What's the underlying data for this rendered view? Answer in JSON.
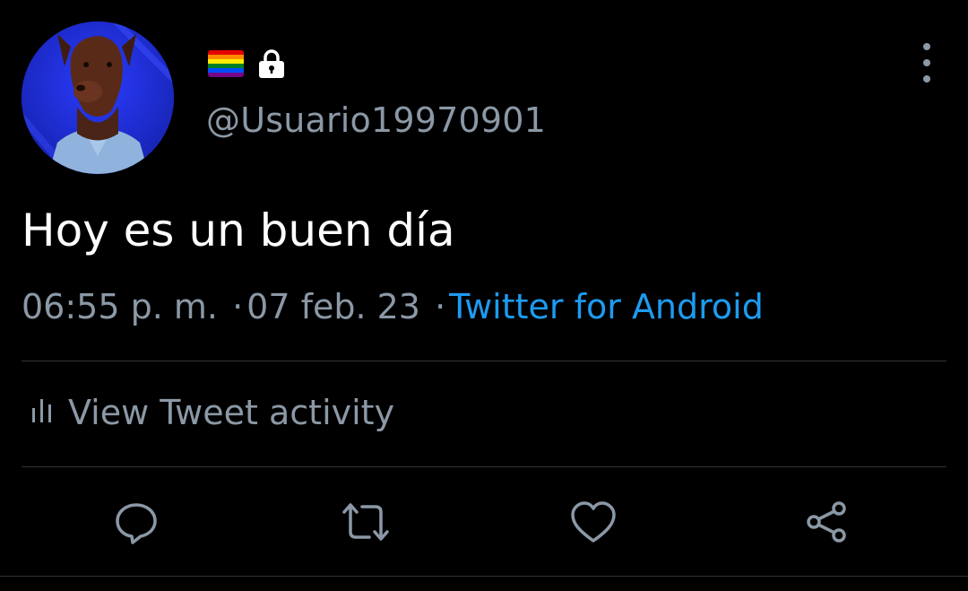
{
  "tweet": {
    "handle": "@Usuario19970901",
    "text": "Hoy es un buen día",
    "time": "06:55 p. m.",
    "date": "07 feb. 23",
    "separator": "·",
    "source": "Twitter for Android"
  },
  "activity": {
    "label": "View Tweet activity",
    "icon": "analytics-icon"
  },
  "icons": {
    "flag": "rainbow-flag-icon",
    "lock": "lock-icon",
    "more": "more-vertical-icon",
    "actions": [
      "reply-icon",
      "retweet-icon",
      "like-icon",
      "share-icon"
    ]
  },
  "colors": {
    "background": "#000000",
    "text": "#ffffff",
    "secondary": "#8b98a5",
    "link": "#1d9bf0",
    "divider": "#2f3336"
  }
}
